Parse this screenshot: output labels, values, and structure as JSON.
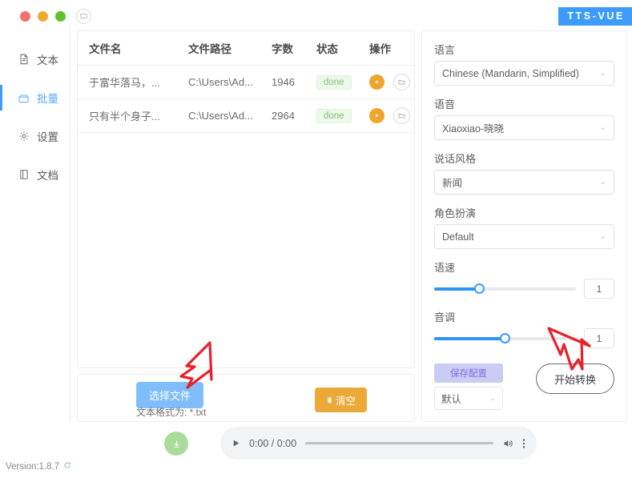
{
  "titlebar": {
    "brand": "TTS-VUE",
    "window_dots": [
      "close-red",
      "minimize-amber",
      "maximize-green"
    ],
    "monitor_icon": "monitor-icon"
  },
  "sidebar": {
    "items": [
      {
        "label": "文本",
        "icon": "document-icon",
        "active": false
      },
      {
        "label": "批量",
        "icon": "batch-box-icon",
        "active": true
      },
      {
        "label": "设置",
        "icon": "gear-icon",
        "active": false
      },
      {
        "label": "文档",
        "icon": "book-icon",
        "active": false
      }
    ]
  },
  "filelist": {
    "columns": [
      "文件名",
      "文件路径",
      "字数",
      "状态",
      "操作"
    ],
    "rows": [
      {
        "name": "于富华落马，...",
        "path": "C:\\Users\\Ad...",
        "count": "1946",
        "state": "done",
        "play_icon": "play-icon",
        "folder_icon": "folder-icon"
      },
      {
        "name": "只有半个身子...",
        "path": "C:\\Users\\Ad...",
        "count": "2964",
        "state": "done",
        "play_icon": "play-icon",
        "folder_icon": "folder-icon"
      }
    ]
  },
  "actions": {
    "select_file": "选择文件",
    "hint": "文本格式为:  *.txt",
    "clear": "清空",
    "clear_icon": "trash-icon"
  },
  "settings": {
    "language": {
      "label": "语言",
      "value": "Chinese (Mandarin, Simplified)"
    },
    "voice": {
      "label": "语音",
      "value": "Xiaoxiao-晓晓"
    },
    "style": {
      "label": "说话风格",
      "value": "新闻"
    },
    "role": {
      "label": "角色扮演",
      "value": "Default"
    },
    "speed": {
      "label": "语速",
      "value": "1",
      "percent": 32
    },
    "pitch": {
      "label": "音调",
      "value": "1",
      "percent": 50
    },
    "save_config": "保存配置",
    "preset": "默认",
    "start_convert": "开始转换"
  },
  "player": {
    "download_icon": "download-icon",
    "play_icon": "play-icon",
    "time": "0:00 / 0:00",
    "volume_icon": "volume-icon",
    "more_icon": "more-vertical-icon",
    "progress_percent": 0
  },
  "footer": {
    "version": "Version:1.8.7",
    "refresh_icon": "refresh-icon"
  },
  "colors": {
    "accent": "#3d9bfb",
    "brand_bg": "#3d9bfb",
    "done_text": "#7dc273",
    "play_orange": "#eea52b",
    "clear_orange": "#eba93a",
    "select_blue": "#7fbdfc",
    "annotation_red": "#e8212a"
  }
}
